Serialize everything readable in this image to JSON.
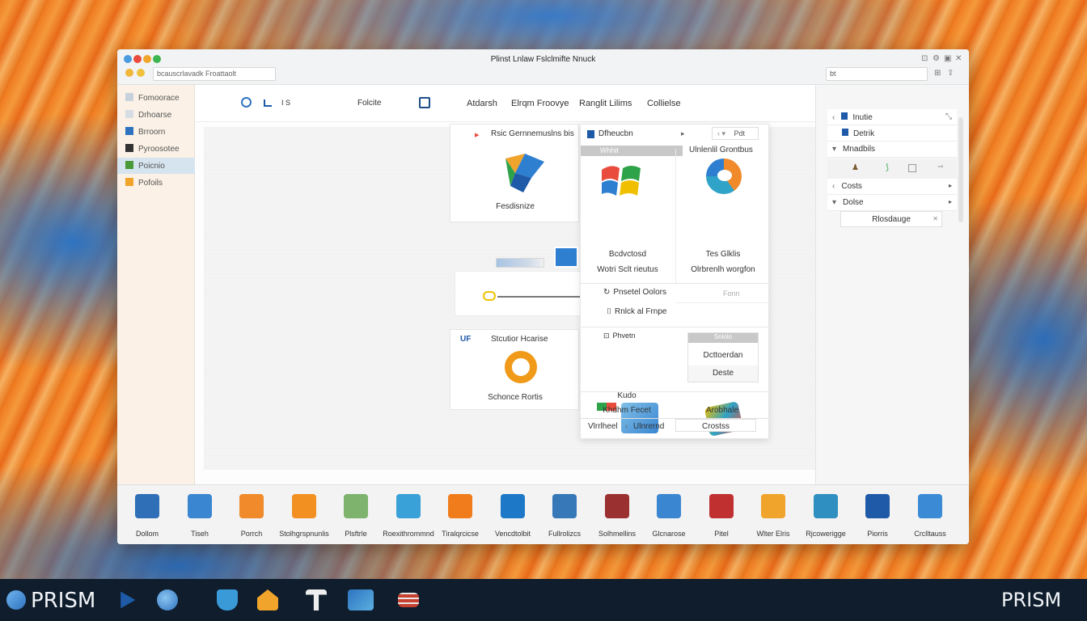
{
  "window": {
    "title": "Plinst Lnlaw Fslclmifte Nnuck",
    "address": "bcauscrlavadk  Froattaolt",
    "search_value": "bt"
  },
  "sidebar": {
    "items": [
      {
        "label": "Fomoorace",
        "icon": "grid-icon"
      },
      {
        "label": "Drhoarse",
        "icon": "folder-icon"
      },
      {
        "label": "Brroorn",
        "icon": "image-icon"
      },
      {
        "label": "Pyroosotee",
        "icon": "file-icon"
      },
      {
        "label": "Poicnio",
        "icon": "photo-icon"
      },
      {
        "label": "Pofoils",
        "icon": "pen-icon"
      }
    ],
    "active_index": 4
  },
  "toolbar": {
    "items": [
      "Folcite",
      "Atdarsh",
      "Elrqm Froovye",
      "Ranglit Lilims",
      "Collielse"
    ],
    "indicator": "I S"
  },
  "cards": {
    "top_left": {
      "title": "Rsic Gernnemuslns bis",
      "label": "Fesdisnize"
    },
    "dropdown": {
      "header": "Dfheucbn",
      "selected": "Whhit",
      "right_badge": "Pdt",
      "right_title": "Ulnlenlil Grontbus",
      "app1_name": "Bcdvctosd",
      "app1_desc": "Wotri Sclt rieutus",
      "app2_name": "Tes Glklis",
      "app2_desc": "Olrbrenlh worgfon",
      "options": [
        "Pnsetel Oolors",
        "Rnlck al Frnpe",
        "Phvetn"
      ],
      "option_hint": "Fonn",
      "sub_header": "Snlolo",
      "sub_items": [
        "Dcttoerdan",
        "Deste"
      ],
      "app3_name": "Kudo",
      "app3_desc": "Khdhm Fecet",
      "app4_name": "Arobhale",
      "footer_left": "Vlrrlheel",
      "footer_mid": "Ulnrernd",
      "footer_right": "Crostss"
    },
    "bottom_left": {
      "title": "Stcutior Hcarise",
      "label": "Schonce Rortis"
    }
  },
  "right_panel": {
    "rows": [
      {
        "label": "Inutie",
        "caret": "‹"
      },
      {
        "label": "Detrik",
        "caret": ""
      },
      {
        "label": "Mnadbils",
        "caret": "▾"
      },
      {
        "label": "Costs",
        "caret": "‹"
      },
      {
        "label": "Dolse",
        "caret": "▾"
      },
      {
        "label": "Rlosdauge",
        "caret": ""
      }
    ]
  },
  "dock": {
    "items": [
      {
        "label": "Dollom",
        "icon": "document-icon",
        "color": "#2f6fb8"
      },
      {
        "label": "Tiseh",
        "icon": "puzzle-icon",
        "color": "#3a86d0"
      },
      {
        "label": "Porrch",
        "icon": "paint-icon",
        "color": "#f08a2a"
      },
      {
        "label": "Stolhgrspnunlis",
        "icon": "orange-icon",
        "color": "#f29022"
      },
      {
        "label": "Plsftrle",
        "icon": "map-icon",
        "color": "#7db36c"
      },
      {
        "label": "Roexithrommnd",
        "icon": "globe-icon",
        "color": "#3aa0d8"
      },
      {
        "label": "Tiralqrcicse",
        "icon": "box-icon",
        "color": "#f07c1c"
      },
      {
        "label": "Vencdtolbit",
        "icon": "flag-icon",
        "color": "#1e78c8"
      },
      {
        "label": "Fullrolizcs",
        "icon": "monitor-icon",
        "color": "#3678b8"
      },
      {
        "label": "Solhmellins",
        "icon": "frame-icon",
        "color": "#9a3030"
      },
      {
        "label": "Glcnarose",
        "icon": "pen-icon",
        "color": "#3a86d0"
      },
      {
        "label": "Pitel",
        "icon": "diamond-icon",
        "color": "#c03030"
      },
      {
        "label": "Wlter Elris",
        "icon": "folder-icon",
        "color": "#f0a42c"
      },
      {
        "label": "Rjcowerigge",
        "icon": "swirl-icon",
        "color": "#2e8fc0"
      },
      {
        "label": "Piorris",
        "icon": "book-icon",
        "color": "#1e5aa8"
      },
      {
        "label": "Crclltauss",
        "icon": "cloud-icon",
        "color": "#3a8ad6"
      }
    ]
  },
  "taskbar": {
    "brand_left": "PRISM",
    "brand_right": "PRISM",
    "icons": [
      "play-icon",
      "globe-icon",
      "shield-icon",
      "home-icon",
      "pin-icon",
      "window-icon",
      "stack-icon"
    ]
  },
  "colors": {
    "accent": "#2f73c0",
    "orange": "#f07a20",
    "taskbar": "#0f1d2c"
  }
}
